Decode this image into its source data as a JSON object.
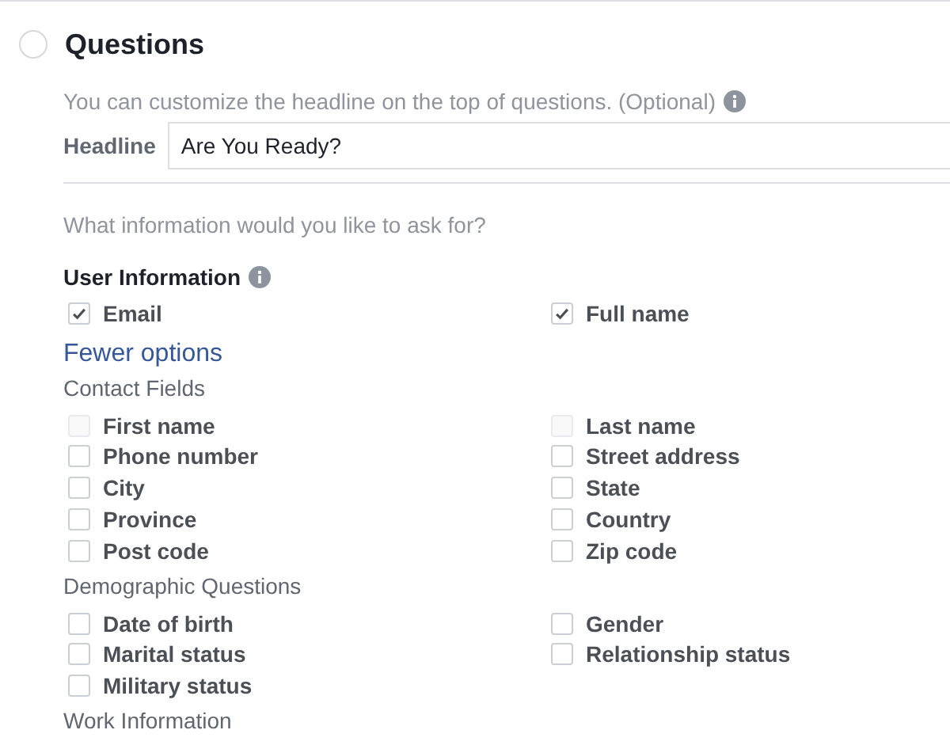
{
  "section": {
    "title": "Questions",
    "selected": false
  },
  "headline_hint": "You can customize the headline on the top of questions. (Optional)",
  "headline": {
    "label": "Headline",
    "value": "Are You Ready?"
  },
  "prompt": "What information would you like to ask for?",
  "user_information": {
    "title": "User Information",
    "options": [
      {
        "label": "Email",
        "checked": true,
        "disabled": false
      },
      {
        "label": "Full name",
        "checked": true,
        "disabled": false
      }
    ]
  },
  "toggle_link": "Fewer options",
  "groups": [
    {
      "title": "Contact Fields",
      "options": [
        {
          "label": "First name",
          "checked": false,
          "disabled": true
        },
        {
          "label": "Last name",
          "checked": false,
          "disabled": true
        },
        {
          "label": "Phone number",
          "checked": false,
          "disabled": false
        },
        {
          "label": "Street address",
          "checked": false,
          "disabled": false
        },
        {
          "label": "City",
          "checked": false,
          "disabled": false
        },
        {
          "label": "State",
          "checked": false,
          "disabled": false
        },
        {
          "label": "Province",
          "checked": false,
          "disabled": false
        },
        {
          "label": "Country",
          "checked": false,
          "disabled": false
        },
        {
          "label": "Post code",
          "checked": false,
          "disabled": false
        },
        {
          "label": "Zip code",
          "checked": false,
          "disabled": false
        }
      ]
    },
    {
      "title": "Demographic Questions",
      "options": [
        {
          "label": "Date of birth",
          "checked": false,
          "disabled": false
        },
        {
          "label": "Gender",
          "checked": false,
          "disabled": false
        },
        {
          "label": "Marital status",
          "checked": false,
          "disabled": false
        },
        {
          "label": "Relationship status",
          "checked": false,
          "disabled": false
        },
        {
          "label": "Military status",
          "checked": false,
          "disabled": false
        }
      ]
    },
    {
      "title": "Work Information"
    }
  ]
}
